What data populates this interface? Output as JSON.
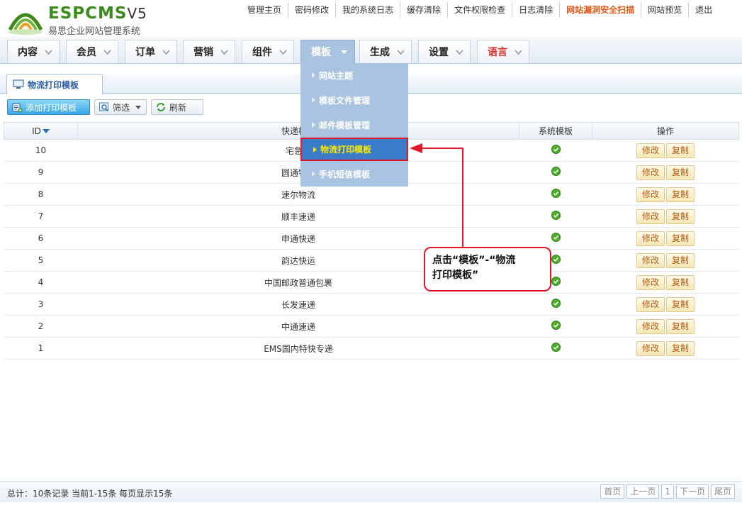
{
  "brand": {
    "title": "ESPCMS",
    "version": "V5",
    "subtitle": "易思企业网站管理系统"
  },
  "topnav": [
    {
      "label": "管理主页",
      "warn": false
    },
    {
      "label": "密码修改",
      "warn": false
    },
    {
      "label": "我的系统日志",
      "warn": false
    },
    {
      "label": "缓存清除",
      "warn": false
    },
    {
      "label": "文件权限检查",
      "warn": false
    },
    {
      "label": "日志清除",
      "warn": false
    },
    {
      "label": "网站漏洞安全扫描",
      "warn": true
    },
    {
      "label": "网站预览",
      "warn": false
    },
    {
      "label": "退出",
      "warn": false
    }
  ],
  "mainnav": [
    {
      "label": "内容"
    },
    {
      "label": "会员"
    },
    {
      "label": "订单"
    },
    {
      "label": "营销"
    },
    {
      "label": "组件"
    },
    {
      "label": "模板",
      "active": true
    },
    {
      "label": "生成"
    },
    {
      "label": "设置"
    },
    {
      "label": "语言",
      "lang": true
    }
  ],
  "dropdown": {
    "items": [
      {
        "label": "网站主题"
      },
      {
        "label": "模板文件管理"
      },
      {
        "label": "邮件模板管理"
      },
      {
        "label": "物流打印模板",
        "selected": true
      },
      {
        "label": "手机短信模板"
      }
    ]
  },
  "content_tab": {
    "label": "物流打印模板"
  },
  "toolbar": {
    "add_label": "添加打印模板",
    "filter_label": "筛选",
    "refresh_label": "刷新"
  },
  "table": {
    "headers": {
      "id": "ID",
      "name": "快递模板",
      "system": "系统模板",
      "ops": "操作"
    },
    "edit_label": "修改",
    "copy_label": "复制",
    "rows": [
      {
        "id": "10",
        "name": "宅急送"
      },
      {
        "id": "9",
        "name": "圆通物流"
      },
      {
        "id": "8",
        "name": "速尔物流"
      },
      {
        "id": "7",
        "name": "顺丰速递"
      },
      {
        "id": "6",
        "name": "申通快递"
      },
      {
        "id": "5",
        "name": "韵达快运"
      },
      {
        "id": "4",
        "name": "中国邮政普通包裹"
      },
      {
        "id": "3",
        "name": "长发速递"
      },
      {
        "id": "2",
        "name": "中通速递"
      },
      {
        "id": "1",
        "name": "EMS国内特快专递"
      }
    ]
  },
  "annotation": {
    "line1": "点击“模板”-“物流",
    "line2": "打印模板”"
  },
  "footer": {
    "summary": "总计：10条记录 当前1-15条 每页显示15条",
    "pager": {
      "first": "首页",
      "prev": "上一页",
      "page": "1",
      "next": "下一页",
      "last": "尾页"
    }
  },
  "colors": {
    "brand_green": "#3d8a1c",
    "warn_orange": "#e2591a",
    "nav_active": "#a9c4e0",
    "selected_item": "#3a7cc8",
    "annotation_red": "#e3152a"
  }
}
